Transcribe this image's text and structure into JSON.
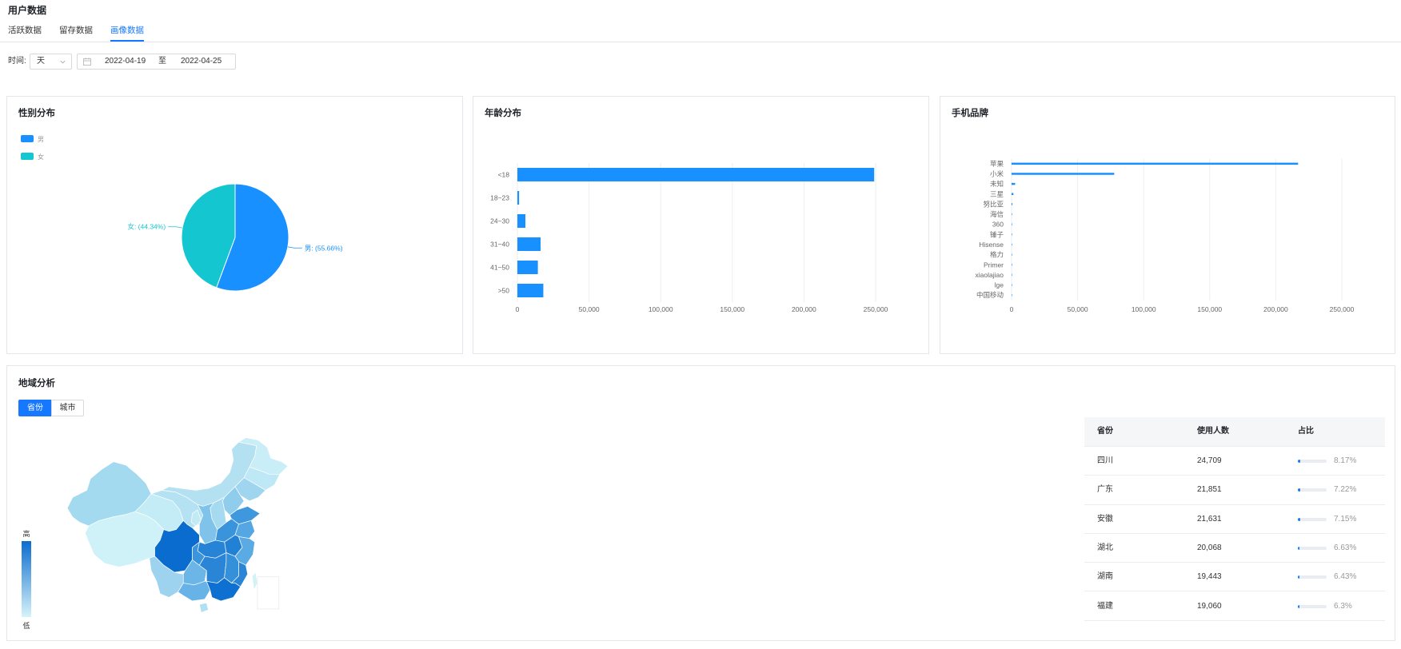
{
  "page": {
    "title": "用户数据"
  },
  "tabs": [
    {
      "label": "活跃数据",
      "active": false
    },
    {
      "label": "留存数据",
      "active": false
    },
    {
      "label": "画像数据",
      "active": true
    }
  ],
  "filter": {
    "label": "时间:",
    "granularity": "天",
    "start_date": "2022-04-19",
    "separator": "至",
    "end_date": "2022-04-25"
  },
  "icons": {
    "granularity_select": "chevron-down-icon",
    "date_range": "calendar-icon"
  },
  "colors": {
    "accent": "#1677ff",
    "bar": "#1890ff",
    "male": "#1890ff",
    "female": "#13c6d0",
    "map_high": "#0a6ccf",
    "map_low": "#d6f3f9"
  },
  "chart_data": [
    {
      "type": "pie",
      "title": "性别分布",
      "labels": [
        "男",
        "女"
      ],
      "values": [
        55.66,
        44.34
      ],
      "data_labels": [
        "男: (55.66%)",
        "女: (44.34%)"
      ],
      "legend_position": "top-left",
      "colors": [
        "#1890ff",
        "#13c6d0"
      ]
    },
    {
      "type": "bar",
      "orientation": "horizontal",
      "title": "年龄分布",
      "categories": [
        "<18",
        "18~23",
        "24~30",
        "31~40",
        "41~50",
        ">50"
      ],
      "values": [
        249000,
        1200,
        5600,
        16200,
        14300,
        18100
      ],
      "xlim": [
        0,
        250000
      ],
      "xticks": [
        "0",
        "50,000",
        "100,000",
        "150,000",
        "200,000",
        "250,000"
      ],
      "grid": true,
      "color": "#1890ff"
    },
    {
      "type": "bar",
      "orientation": "horizontal",
      "title": "手机品牌",
      "categories": [
        "苹果",
        "小米",
        "未知",
        "三星",
        "努比亚",
        "海信",
        "360",
        "锤子",
        "Hisense",
        "格力",
        "Primer",
        "xiaolajiao",
        "lge",
        "中国移动"
      ],
      "values": [
        216900,
        77700,
        2700,
        1400,
        600,
        300,
        200,
        150,
        120,
        80,
        60,
        40,
        30,
        20
      ],
      "xlim": [
        0,
        250000
      ],
      "xticks": [
        "0",
        "50,000",
        "100,000",
        "150,000",
        "200,000",
        "250,000"
      ],
      "grid": true,
      "color": "#1890ff"
    }
  ],
  "region": {
    "title": "地域分析",
    "toggle": [
      {
        "label": "省份",
        "active": true
      },
      {
        "label": "城市",
        "active": false
      }
    ],
    "legend_high": "高",
    "legend_low": "低",
    "table": {
      "columns": [
        "省份",
        "使用人数",
        "占比"
      ],
      "rows": [
        {
          "province": "四川",
          "users": "24,709",
          "share": "8.17%",
          "share_value": 8.17
        },
        {
          "province": "广东",
          "users": "21,851",
          "share": "7.22%",
          "share_value": 7.22
        },
        {
          "province": "安徽",
          "users": "21,631",
          "share": "7.15%",
          "share_value": 7.15
        },
        {
          "province": "湖北",
          "users": "20,068",
          "share": "6.63%",
          "share_value": 6.63
        },
        {
          "province": "湖南",
          "users": "19,443",
          "share": "6.43%",
          "share_value": 6.43
        },
        {
          "province": "福建",
          "users": "19,060",
          "share": "6.3%",
          "share_value": 6.3
        }
      ]
    }
  }
}
